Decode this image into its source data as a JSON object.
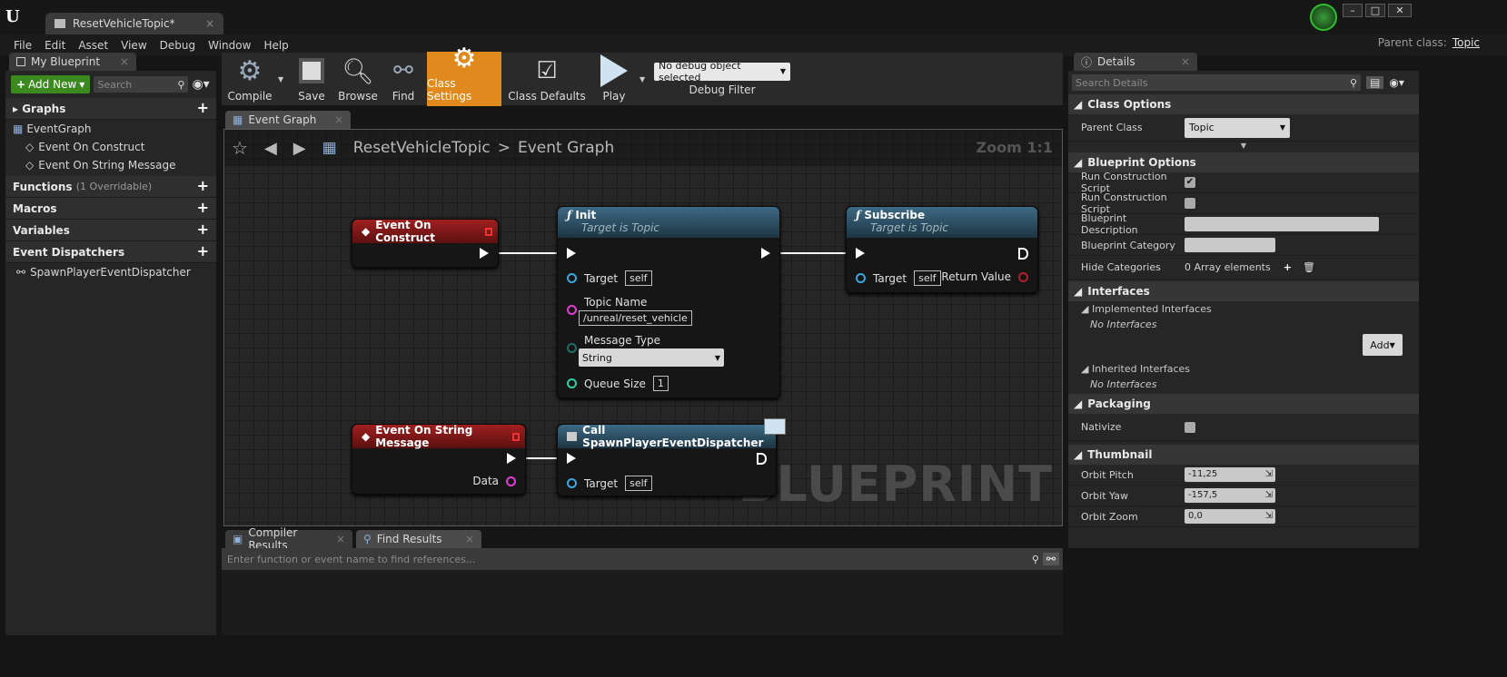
{
  "window": {
    "doc_tab": "ResetVehicleTopic*",
    "parent_class_label": "Parent class:",
    "parent_class_value": "Topic"
  },
  "menu": [
    "File",
    "Edit",
    "Asset",
    "View",
    "Debug",
    "Window",
    "Help"
  ],
  "my_blueprint": {
    "tab": "My Blueprint",
    "add_new": "Add New",
    "search_placeholder": "Search",
    "graphs": "Graphs",
    "event_graph": "EventGraph",
    "graph_items": [
      "Event On Construct",
      "Event On String Message"
    ],
    "functions": "Functions",
    "functions_note": "(1 Overridable)",
    "macros": "Macros",
    "variables": "Variables",
    "event_dispatchers": "Event Dispatchers",
    "dispatcher_item": "SpawnPlayerEventDispatcher"
  },
  "toolbar": {
    "compile": "Compile",
    "save": "Save",
    "browse": "Browse",
    "find": "Find",
    "class_settings": "Class Settings",
    "class_defaults": "Class Defaults",
    "play": "Play",
    "debug_select": "No debug object selected",
    "debug_filter": "Debug Filter"
  },
  "graph": {
    "tab": "Event Graph",
    "breadcrumb_root": "ResetVehicleTopic",
    "breadcrumb_sep": ">",
    "breadcrumb_leaf": "Event Graph",
    "zoom": "Zoom 1:1",
    "watermark": "BLUEPRINT",
    "nodes": {
      "construct": {
        "title": "Event On Construct"
      },
      "init": {
        "title": "Init",
        "subtitle": "Target is Topic",
        "target": "Target",
        "self": "self",
        "topic_name": "Topic Name",
        "topic_value": "/unreal/reset_vehicle",
        "message_type": "Message Type",
        "message_value": "String",
        "queue_size": "Queue Size",
        "queue_value": "1"
      },
      "subscribe": {
        "title": "Subscribe",
        "subtitle": "Target is Topic",
        "target": "Target",
        "self": "self",
        "return_value": "Return Value"
      },
      "string_msg": {
        "title": "Event On String Message",
        "data": "Data"
      },
      "call": {
        "title": "Call SpawnPlayerEventDispatcher",
        "target": "Target",
        "self": "self"
      }
    }
  },
  "bottom": {
    "compiler_tab": "Compiler Results",
    "find_tab": "Find Results",
    "find_placeholder": "Enter function or event name to find references..."
  },
  "details": {
    "tab": "Details",
    "search_placeholder": "Search Details",
    "class_options": "Class Options",
    "parent_class": "Parent Class",
    "parent_class_value": "Topic",
    "blueprint_options": "Blueprint Options",
    "run_construction_1": "Run Construction Script",
    "run_construction_2": "Run Construction Script",
    "blueprint_description": "Blueprint Description",
    "blueprint_category": "Blueprint Category",
    "hide_categories": "Hide Categories",
    "hide_categories_value": "0 Array elements",
    "interfaces": "Interfaces",
    "implemented": "Implemented Interfaces",
    "no_interfaces_1": "No Interfaces",
    "add": "Add",
    "inherited": "Inherited Interfaces",
    "no_interfaces_2": "No Interfaces",
    "packaging": "Packaging",
    "nativize": "Nativize",
    "thumbnail": "Thumbnail",
    "orbit_pitch": "Orbit Pitch",
    "orbit_pitch_value": "-11,25",
    "orbit_yaw": "Orbit Yaw",
    "orbit_yaw_value": "-157,5",
    "orbit_zoom": "Orbit Zoom",
    "orbit_zoom_value": "0,0"
  }
}
